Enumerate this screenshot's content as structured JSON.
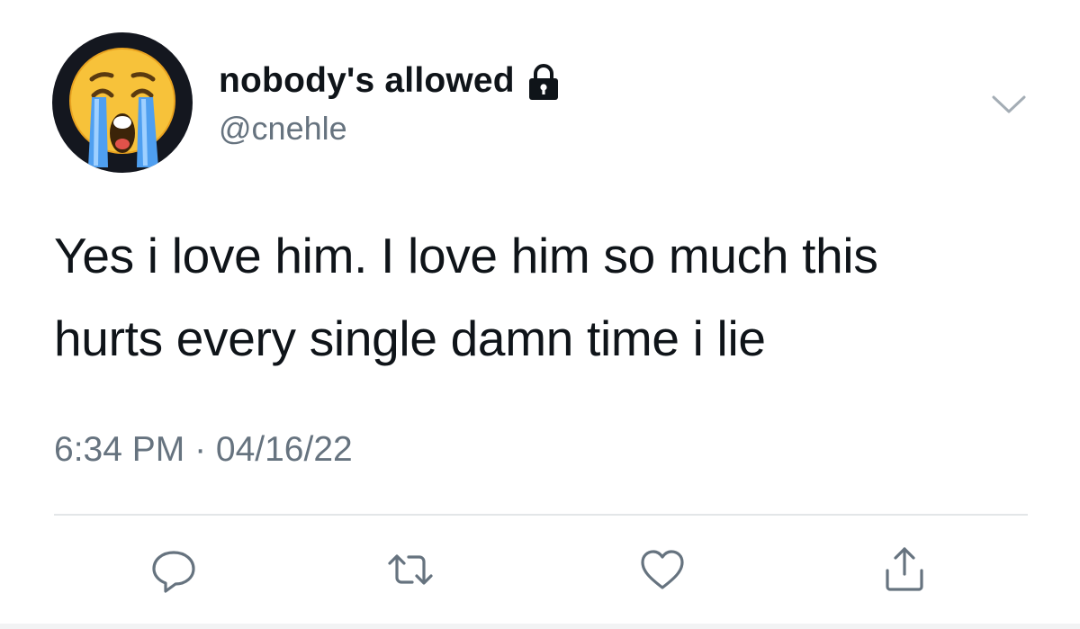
{
  "tweet": {
    "display_name": "nobody's allowed",
    "handle": "@cnehle",
    "text_lines": [
      "Yes i love him. I love him so much this",
      "hurts every single damn time i lie"
    ],
    "timestamp": "6:34 PM · 04/16/22"
  },
  "icons": {
    "avatar": "loudly-crying-face-emoji",
    "protected": "lock-icon",
    "menu": "chevron-down-icon",
    "reply": "reply-bubble-icon",
    "retweet": "retweet-icon",
    "like": "heart-icon",
    "share": "share-upload-icon"
  },
  "colors": {
    "primary_text": "#0f1419",
    "secondary_text": "#66737f",
    "icon_gray": "#66737f",
    "divider": "#e3e6e8",
    "avatar_bg": "#14171f"
  }
}
